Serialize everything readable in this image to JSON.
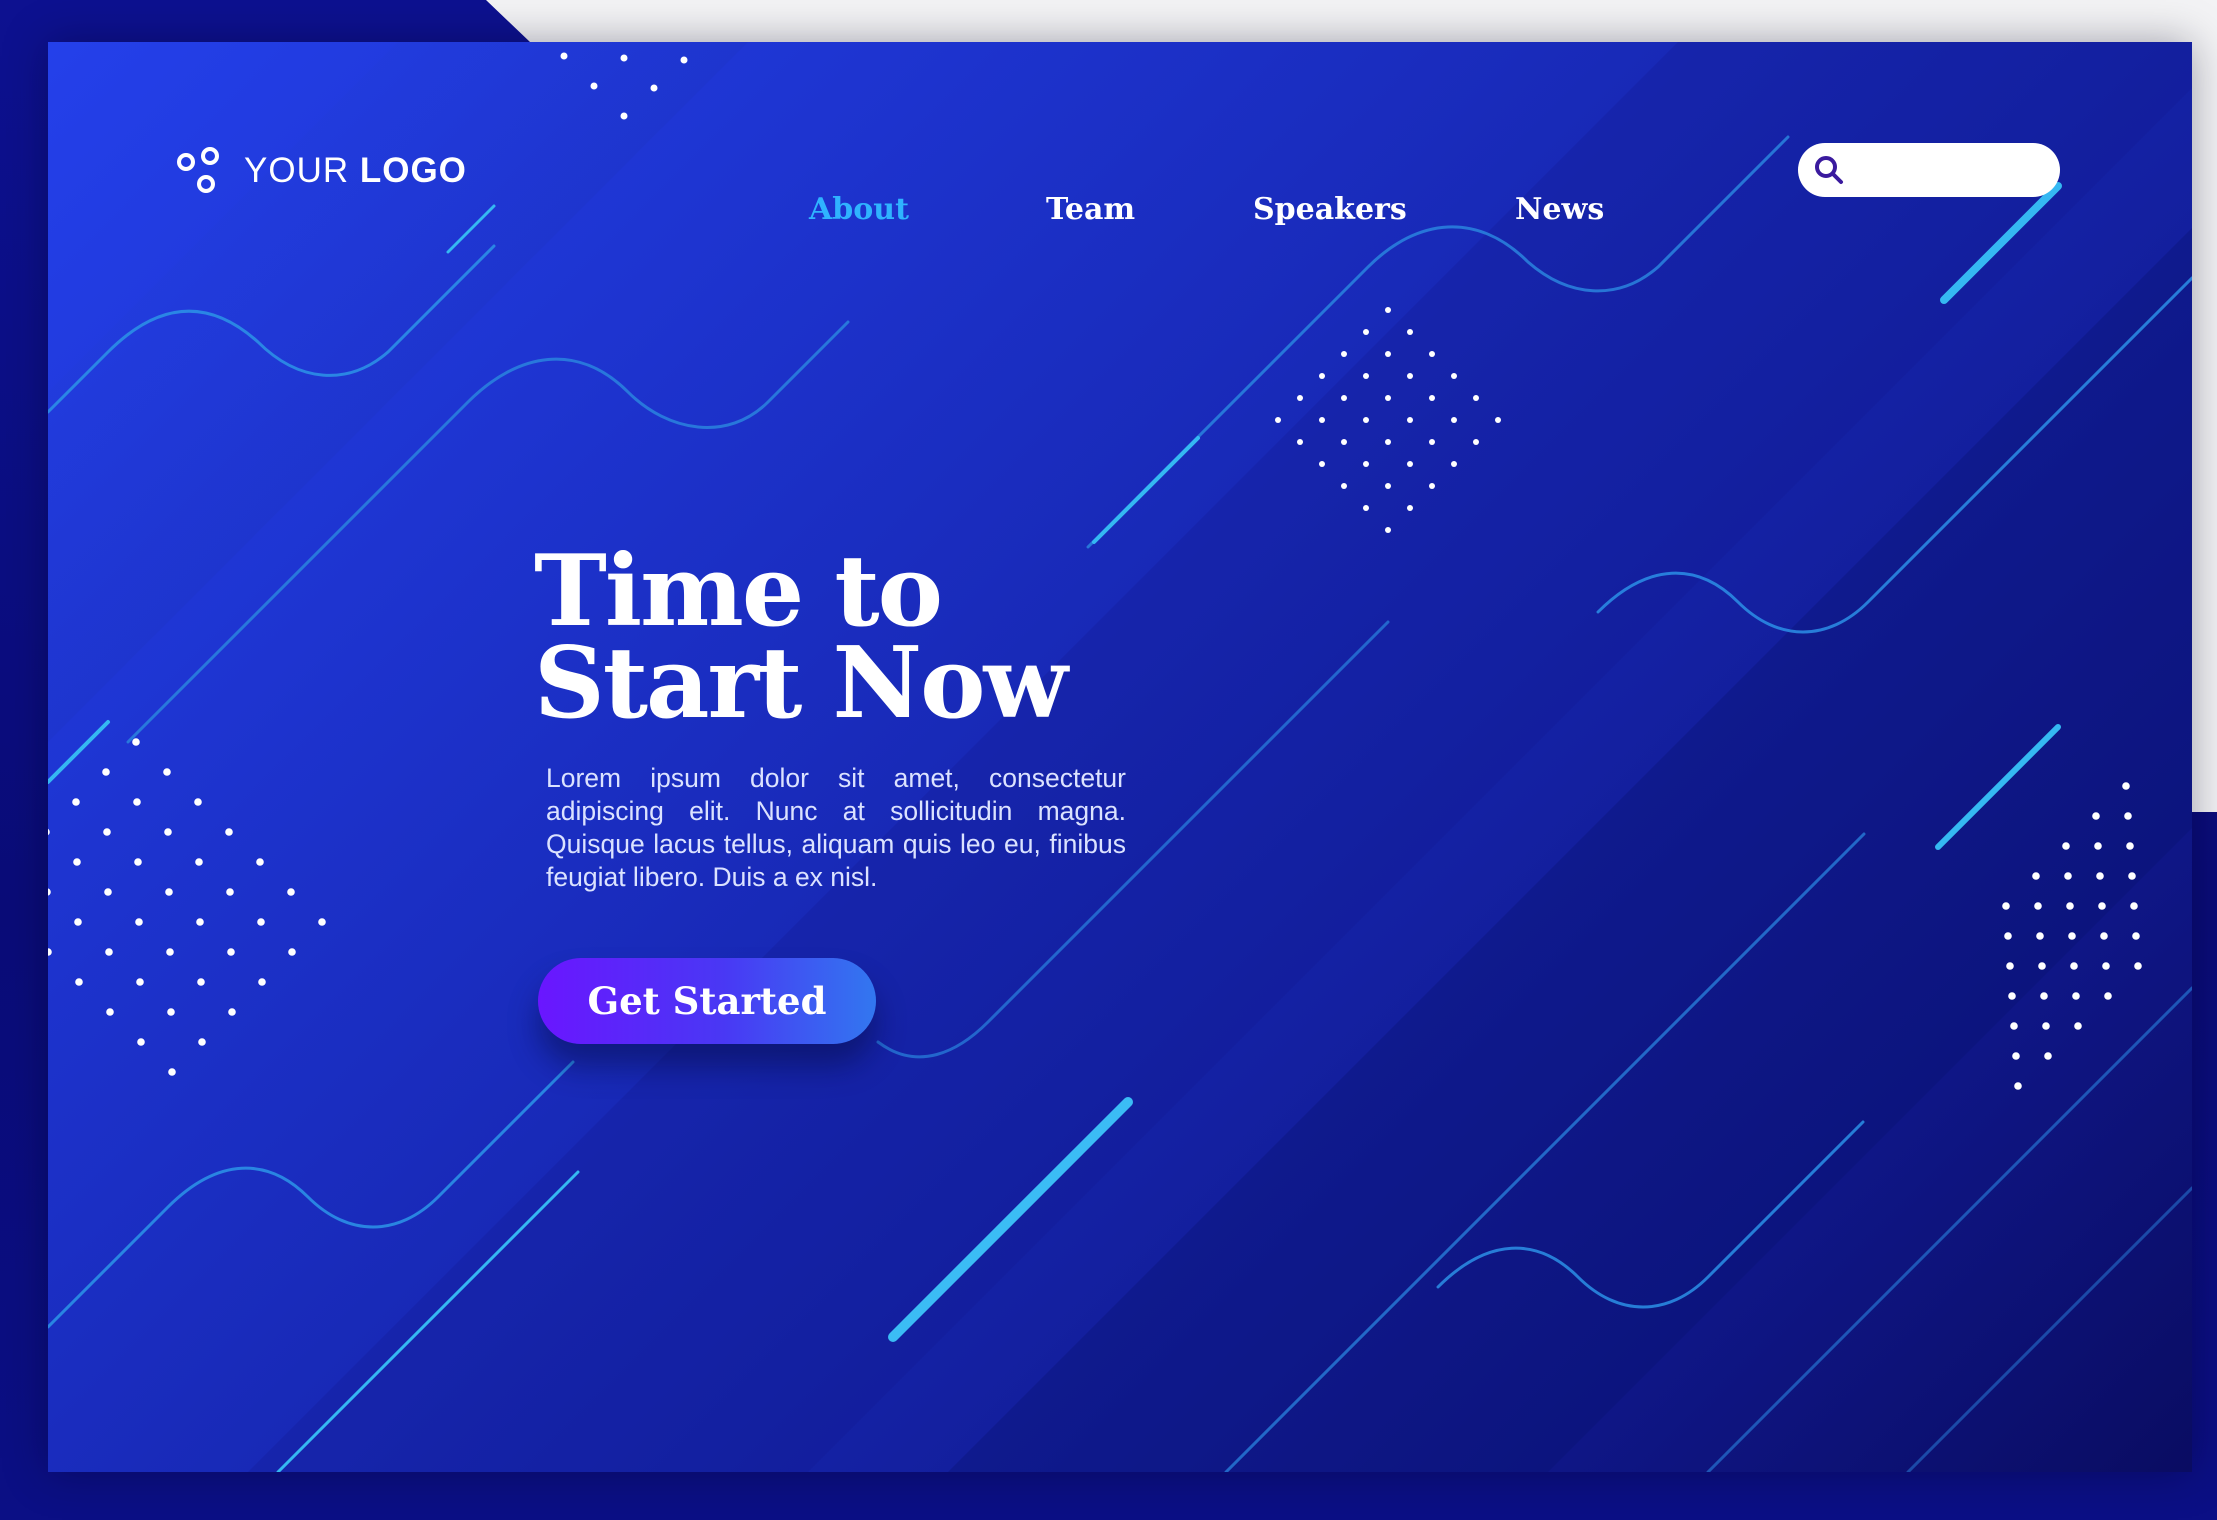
{
  "header": {
    "logo": {
      "text_regular": "YOUR",
      "text_bold": "LOGO"
    },
    "nav": [
      {
        "label": "About",
        "active": true
      },
      {
        "label": "Team",
        "active": false
      },
      {
        "label": "Speakers",
        "active": false
      },
      {
        "label": "News",
        "active": false
      }
    ],
    "search": {
      "value": "",
      "placeholder": "",
      "icon": "search-icon"
    }
  },
  "hero": {
    "title_line1": "Time to",
    "title_line2": "Start Now",
    "body": "Lorem ipsum dolor sit amet, consectetur adipiscing elit. Nunc at sollicitudin magna. Quisque lacus tellus, aliquam quis leo eu, finibus feugiat libero. Duis a ex nisl.",
    "cta_label": "Get Started"
  },
  "colors": {
    "background_top": "#2440ea",
    "background_bottom": "#0a0c62",
    "nav_active": "#2fb3ff",
    "nav_text": "#ffffff",
    "accent_line": "#35b8f2",
    "cta_start": "#6a16ff",
    "cta_end": "#3277f0",
    "search_icon": "#3a1a9e"
  }
}
